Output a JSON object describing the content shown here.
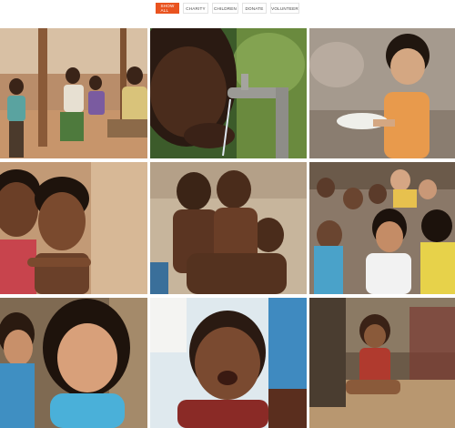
{
  "filters": {
    "items": [
      {
        "label": "SHOW ALL",
        "active": true
      },
      {
        "label": "CHARITY",
        "active": false
      },
      {
        "label": "CHILDREN",
        "active": false
      },
      {
        "label": "DONATE",
        "active": false
      },
      {
        "label": "VOLUNTEER",
        "active": false
      }
    ],
    "active_color": "#e9531f"
  },
  "gallery": {
    "photos": [
      {
        "icon": "photo-children-village"
      },
      {
        "icon": "photo-girl-drinking-tap"
      },
      {
        "icon": "photo-boy-holding-bowl"
      },
      {
        "icon": "photo-two-children-hugging"
      },
      {
        "icon": "photo-group-of-boys"
      },
      {
        "icon": "photo-crowd-of-children"
      },
      {
        "icon": "photo-little-girl-portrait"
      },
      {
        "icon": "photo-crying-child"
      },
      {
        "icon": "photo-girl-sitting-ground"
      }
    ]
  }
}
